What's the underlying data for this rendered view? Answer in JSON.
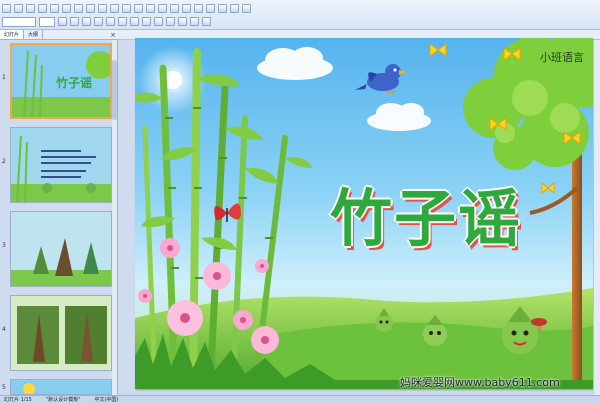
{
  "left_pane": {
    "tabs": [
      "幻灯片",
      "大纲"
    ],
    "close_glyph": "×",
    "slide_numbers": [
      "1",
      "2",
      "3",
      "4",
      "5"
    ],
    "thumb1_title": "竹子谣"
  },
  "slide": {
    "title": "竹子谣",
    "subtitle": "小班语言"
  },
  "watermark": "妈咪爱婴网www.baby611.com",
  "status": {
    "slide_counter": "幻灯片 1/15",
    "design": "\"默认设计模板\"",
    "language": "中文(中国)"
  },
  "colors": {
    "title_green": "#2fa83e",
    "title_shadow_red": "#e3534e",
    "sky_blue": "#55b3ee",
    "grass_green": "#7cc84a",
    "selection_orange": "#f0a84a"
  },
  "icons": [
    "bird-icon",
    "butterfly-icon",
    "sun-icon"
  ]
}
